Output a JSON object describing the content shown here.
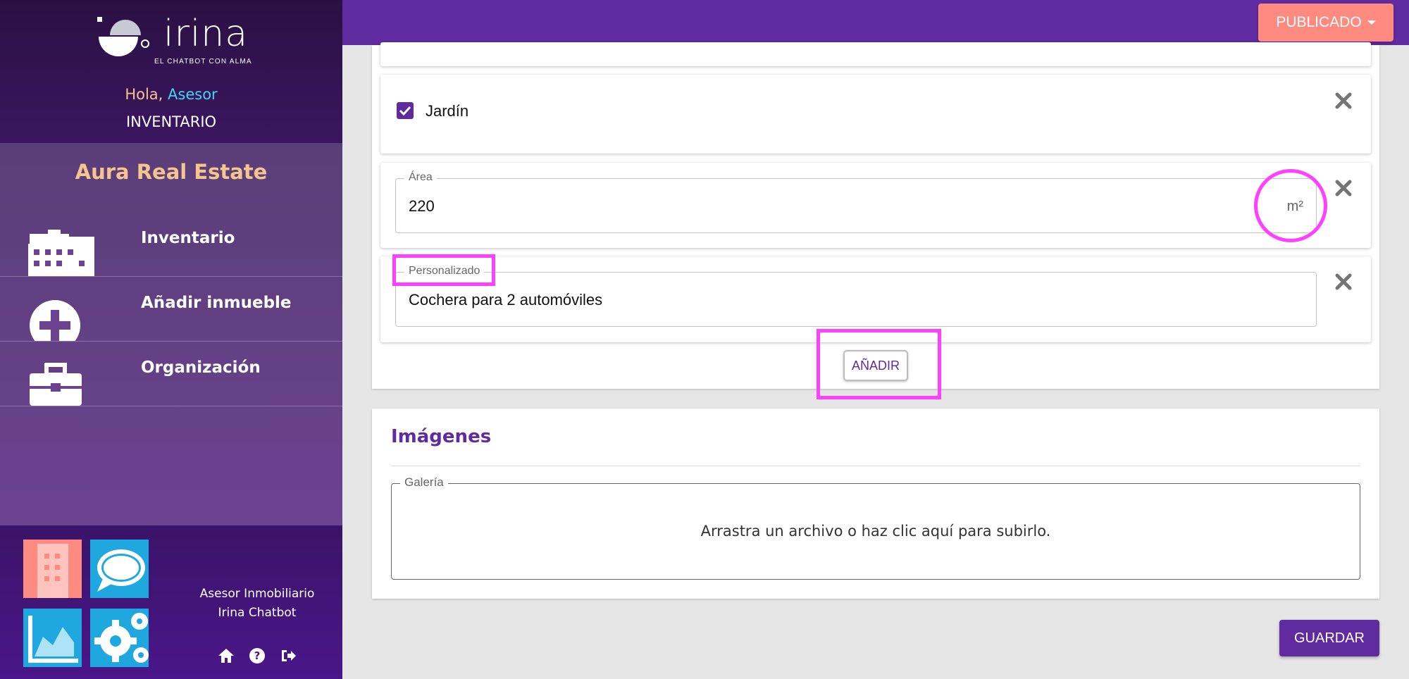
{
  "brand": {
    "name": "irina",
    "tagline": "EL CHATBOT CON ALMA"
  },
  "user": {
    "greeting": "Hola,",
    "name": "Asesor",
    "section": "INVENTARIO"
  },
  "company": "Aura Real Estate",
  "menu": [
    {
      "label": "Inventario",
      "icon": "building-icon"
    },
    {
      "label": "Añadir inmueble",
      "icon": "plus-circle-icon"
    },
    {
      "label": "Organización",
      "icon": "briefcase-icon"
    }
  ],
  "footer": {
    "role_line1": "Asesor Inmobiliario",
    "role_line2": "Irina Chatbot"
  },
  "topbar": {
    "status_label": "PUBLICADO"
  },
  "features": {
    "garden": {
      "label": "Jardín",
      "checked": true
    },
    "area": {
      "legend": "Área",
      "value": "220",
      "unit": "m²"
    },
    "custom": {
      "legend": "Personalizado",
      "value": "Cochera para 2 automóviles"
    },
    "add_label": "AÑADIR"
  },
  "images": {
    "title": "Imágenes",
    "gallery_legend": "Galería",
    "gallery_hint": "Arrastra un archivo o haz clic aquí para subirlo."
  },
  "save_label": "GUARDAR",
  "colors": {
    "primary": "#5f2b9e",
    "accent": "#ff8a80",
    "highlight": "#ff40ff",
    "gold": "#f6c58d",
    "cyan": "#42d6f3"
  }
}
